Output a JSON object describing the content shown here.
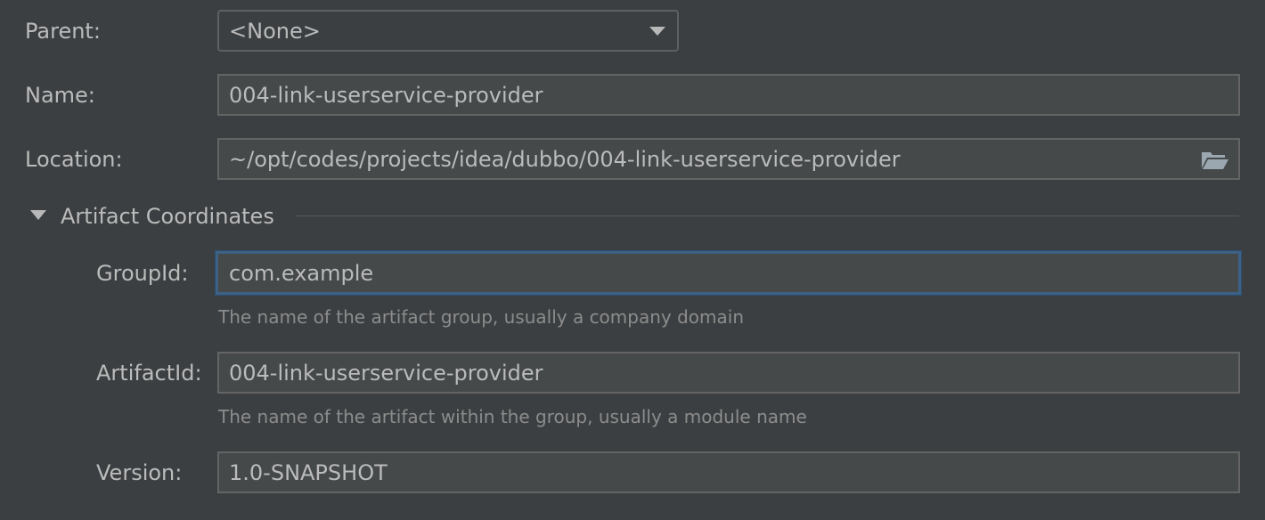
{
  "form": {
    "parent": {
      "label": "Parent:",
      "value": "<None>"
    },
    "name": {
      "label": "Name:",
      "value": "004-link-userservice-provider"
    },
    "location": {
      "label": "Location:",
      "value": "~/opt/codes/projects/idea/dubbo/004-link-userservice-provider",
      "browse_icon": "folder-open-icon"
    }
  },
  "artifact_coordinates": {
    "title": "Artifact Coordinates",
    "expanded": true,
    "group_id": {
      "label": "GroupId:",
      "value": "com.example",
      "hint": "The name of the artifact group, usually a company domain"
    },
    "artifact_id": {
      "label": "ArtifactId:",
      "value": "004-link-userservice-provider",
      "hint": "The name of the artifact within the group, usually a module name"
    },
    "version": {
      "label": "Version:",
      "value": "1.0-SNAPSHOT"
    }
  },
  "colors": {
    "background": "#3c3f41",
    "field_background": "#45494a",
    "focus_border": "#3d6185",
    "text": "#bbbbbb",
    "hint_text": "#8c8c8c"
  }
}
